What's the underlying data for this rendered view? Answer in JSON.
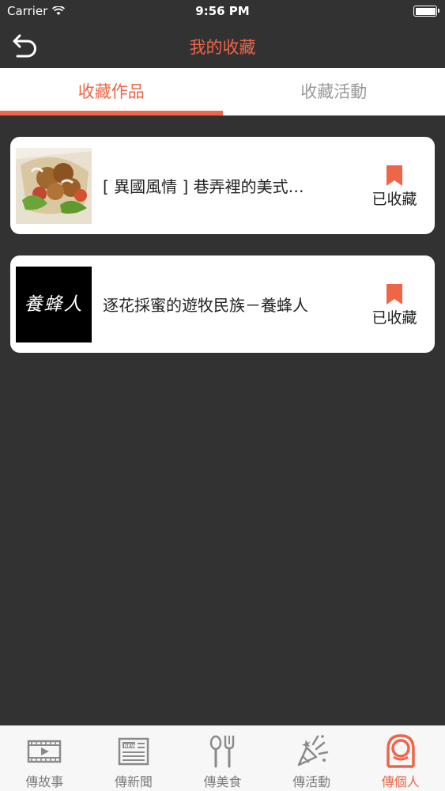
{
  "status_bar": {
    "carrier": "Carrier",
    "time": "9:56 PM"
  },
  "nav": {
    "title": "我的收藏"
  },
  "tabs": [
    {
      "label": "收藏作品",
      "active": true
    },
    {
      "label": "收藏活動",
      "active": false
    }
  ],
  "favorites": [
    {
      "title": "[ 異國風情 ] 巷弄裡的美式…",
      "status": "已收藏"
    },
    {
      "title": "逐花採蜜的遊牧民族－養蜂人",
      "status": "已收藏",
      "thumb_text": "養蜂人"
    }
  ],
  "tabbar": [
    {
      "label": "傳故事",
      "icon": "film-icon",
      "active": false
    },
    {
      "label": "傳新聞",
      "icon": "news-icon",
      "active": false
    },
    {
      "label": "傳美食",
      "icon": "utensils-icon",
      "active": false
    },
    {
      "label": "傳活動",
      "icon": "party-popper-icon",
      "active": false
    },
    {
      "label": "傳個人",
      "icon": "person-icon",
      "active": true
    }
  ],
  "colors": {
    "accent": "#ee6548",
    "background": "#333233",
    "inactive": "#7d7d7d"
  }
}
